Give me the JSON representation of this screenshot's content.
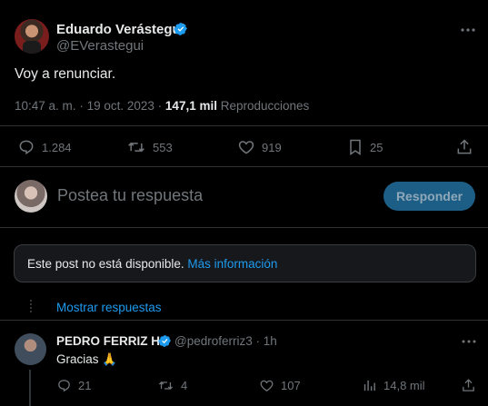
{
  "tweet": {
    "author_name": "Eduardo Verástegui",
    "author_handle": "@EVerastegui",
    "text": "Voy a renunciar.",
    "time": "10:47 a. m.",
    "separator": "·",
    "date": "19 oct. 2023",
    "views_count": "147,1 mil",
    "views_label": "Reproducciones",
    "stats": {
      "replies": "1.284",
      "retweets": "553",
      "likes": "919",
      "bookmarks": "25"
    }
  },
  "composer": {
    "placeholder": "Postea tu respuesta",
    "button_label": "Responder"
  },
  "unavailable": {
    "text": "Este post no está disponible.",
    "link": "Más información"
  },
  "thread": {
    "show_replies": "Mostrar respuestas"
  },
  "reply": {
    "author_name": "PEDRO FERRIZ H",
    "author_handle": "@pedroferriz3 · 1h",
    "text": "Gracias 🙏",
    "stats": {
      "replies": "21",
      "retweets": "4",
      "likes": "107",
      "views": "14,8 mil"
    }
  },
  "colors": {
    "background": "#000000",
    "text": "#e7e9ea",
    "muted": "#71767b",
    "accent": "#1d9bf0",
    "border": "#2f3336",
    "button_bg": "#1d5e87"
  },
  "icons": [
    "verified-badge-icon",
    "more-icon",
    "reply-icon",
    "retweet-icon",
    "like-icon",
    "bookmark-icon",
    "share-icon",
    "views-icon"
  ]
}
